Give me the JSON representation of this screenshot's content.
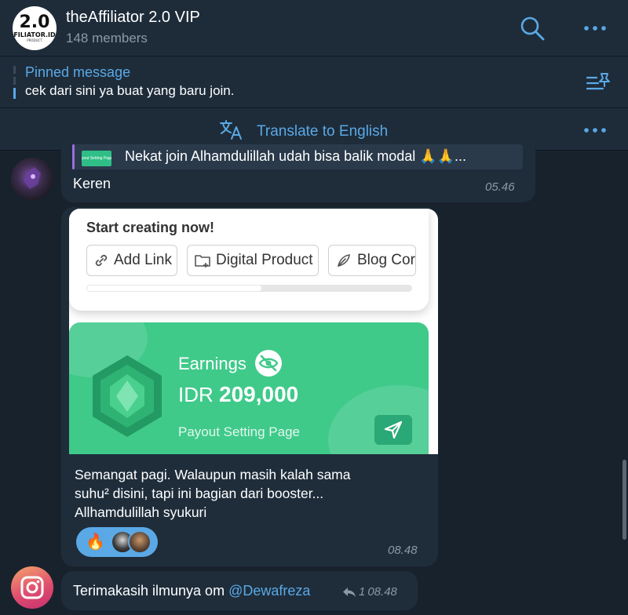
{
  "header": {
    "logo_big": "2.0",
    "logo_small": "FILIATOR.ID",
    "logo_tiny": "PRODUCT",
    "title": "theAffiliator 2.0 VIP",
    "subtitle": "148 members"
  },
  "pinned": {
    "label": "Pinned message",
    "text": "cek dari sini ya buat yang baru join."
  },
  "translate": {
    "label": "Translate to English"
  },
  "messages": [
    {
      "reply_thumb_text": "yout Setting Page",
      "reply_text": "Nekat join Alhamdulillah udah bisa balik modal 🙏🙏...",
      "text": "Keren",
      "time": "05.46"
    },
    {
      "photo": {
        "card_title": "Start creating now!",
        "chips": [
          "Add Link",
          "Digital Product",
          "Blog Cor"
        ],
        "progress": 0.54,
        "earnings_label": "Earnings",
        "currency": "IDR",
        "amount": "209,000",
        "payout_link": "Payout Setting Page"
      },
      "lines": [
        "Semangat pagi. Walaupun masih kalah sama",
        "suhu² disini, tapi ini bagian dari booster...",
        "Allhamdulillah syukuri"
      ],
      "reaction_emoji": "🔥",
      "time": "08.48"
    },
    {
      "text": "Terimakasih ilmunya om ",
      "mention": "@Dewafreza",
      "reply_count": "1",
      "time": "08.48"
    }
  ],
  "colors": {
    "background": "#18222d",
    "header": "#1e2c3a",
    "accent": "#5aa9e6",
    "bubble": "#1f2d3b",
    "earnings_card": "#3fca8a"
  }
}
